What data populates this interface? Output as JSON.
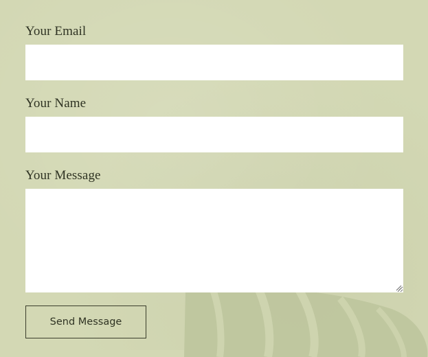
{
  "contact_form": {
    "email": {
      "label": "Your Email",
      "value": "",
      "placeholder": ""
    },
    "name": {
      "label": "Your Name",
      "value": "",
      "placeholder": ""
    },
    "message": {
      "label": "Your Message",
      "value": "",
      "placeholder": ""
    },
    "submit_label": "Send Message"
  },
  "colors": {
    "background": "#d3d8b4",
    "text": "#2f3323",
    "field_background": "#ffffff",
    "button_border": "#3a3d2b",
    "leaf": "#bcc49c"
  },
  "icons": {
    "decoration": "monstera-leaf-icon",
    "textarea_resize": "resize-grip-icon"
  }
}
